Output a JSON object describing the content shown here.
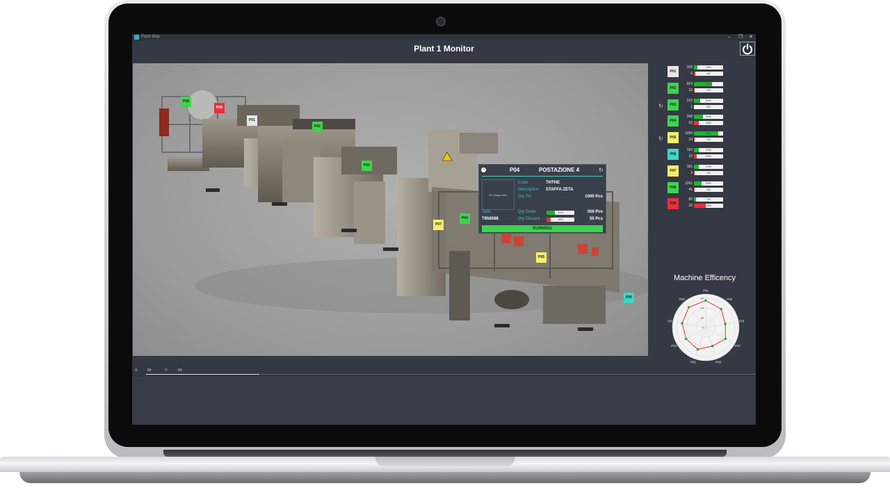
{
  "window": {
    "title": "Plant Map",
    "minimize": "–",
    "restore": "❐",
    "close": "✕"
  },
  "page": {
    "title": "Plant 1 Monitor"
  },
  "map_tags": [
    {
      "label": "P08",
      "color": "green"
    },
    {
      "label": "P09",
      "color": "red"
    },
    {
      "label": "P01",
      "color": "white"
    },
    {
      "label": "P02",
      "color": "green"
    },
    {
      "label": "P03",
      "color": "green"
    },
    {
      "label": "P04",
      "color": "green"
    },
    {
      "label": "P07",
      "color": "yellow"
    },
    {
      "label": "P05",
      "color": "yellow"
    },
    {
      "label": "P06",
      "color": "cyan"
    }
  ],
  "popup": {
    "station": "P04",
    "name": "POSTAZIONE 4",
    "no_image": "No image data",
    "code_label": "Code",
    "code": "THTHE",
    "desc_label": "Description",
    "desc": "STAFFA ZETA",
    "qty_tot_label": "Qty Tot",
    "qty_tot": "1000 Pcs",
    "task_label": "Task",
    "task": "T956598",
    "qty_done_label": "Qty Done",
    "qty_done_pct": "31%",
    "qty_done": "306 Pcs",
    "qty_done_frac": 0.31,
    "qty_discard_label": "Qty Discard",
    "qty_discard_pct": "16%",
    "qty_discard": "55 Pcs",
    "qty_discard_frac": 0.16,
    "status": "RUNNING"
  },
  "machines": [
    {
      "label": "P01",
      "color": "white",
      "top": "158",
      "top_pct": "13%",
      "top_frac": 0.13,
      "bottom": "6",
      "bottom_pct": "4%",
      "bottom_frac": 0.04,
      "refresh": false
    },
    {
      "label": "P02",
      "color": "green",
      "top": "604",
      "top_pct": "61%",
      "top_frac": 0.61,
      "bottom": "12",
      "bottom_pct": "2%",
      "bottom_frac": 0.02,
      "refresh": false
    },
    {
      "label": "P03",
      "color": "green",
      "top": "215",
      "top_pct": "21%",
      "top_frac": 0.21,
      "bottom": "1",
      "bottom_pct": "0%",
      "bottom_frac": 0.0,
      "refresh": true
    },
    {
      "label": "P04",
      "color": "green",
      "top": "298",
      "top_pct": "30%",
      "top_frac": 0.3,
      "bottom": "52",
      "bottom_pct": "16%",
      "bottom_frac": 0.16,
      "refresh": false
    },
    {
      "label": "P05",
      "color": "yellow",
      "top": "1299",
      "top_pct": "83%",
      "top_frac": 0.83,
      "bottom": "19",
      "bottom_pct": "1%",
      "bottom_frac": 0.01,
      "refresh": true
    },
    {
      "label": "P06",
      "color": "cyan",
      "top": "183",
      "top_pct": "17%",
      "top_frac": 0.17,
      "bottom": "15",
      "bottom_pct": "10%",
      "bottom_frac": 0.1,
      "refresh": false
    },
    {
      "label": "P07",
      "color": "yellow",
      "top": "181",
      "top_pct": "17%",
      "top_frac": 0.17,
      "bottom": "3",
      "bottom_pct": "1%",
      "bottom_frac": 0.01,
      "refresh": false
    },
    {
      "label": "P08",
      "color": "green",
      "top": "1261",
      "top_pct": "26%",
      "top_frac": 0.26,
      "bottom": "41",
      "bottom_pct": "3%",
      "bottom_frac": 0.03,
      "refresh": false
    },
    {
      "label": "P09",
      "color": "red",
      "top": "82",
      "top_pct": "7%",
      "top_frac": 0.07,
      "bottom": "33",
      "bottom_pct": "40%",
      "bottom_frac": 0.4,
      "refresh": false
    }
  ],
  "efficiency": {
    "title": "Machine Efficency",
    "axis_ticks": [
      "90",
      "60",
      "30",
      "0"
    ],
    "categories": [
      "P01",
      "P09",
      "P08",
      "P07",
      "P06",
      "P05",
      "P04",
      "P03",
      "P02"
    ],
    "values": [
      92,
      82,
      68,
      78,
      68,
      80,
      78,
      82,
      90
    ]
  },
  "status": {
    "x_label": "X:",
    "x": "66",
    "y_label": "Y:",
    "y": "69"
  },
  "colors": {
    "green": "#3fd24f",
    "red": "#e8303c",
    "white": "#e6e6e6",
    "yellow": "#f3ee6a",
    "cyan": "#3fd6c4",
    "accent": "#3fd6c4"
  }
}
